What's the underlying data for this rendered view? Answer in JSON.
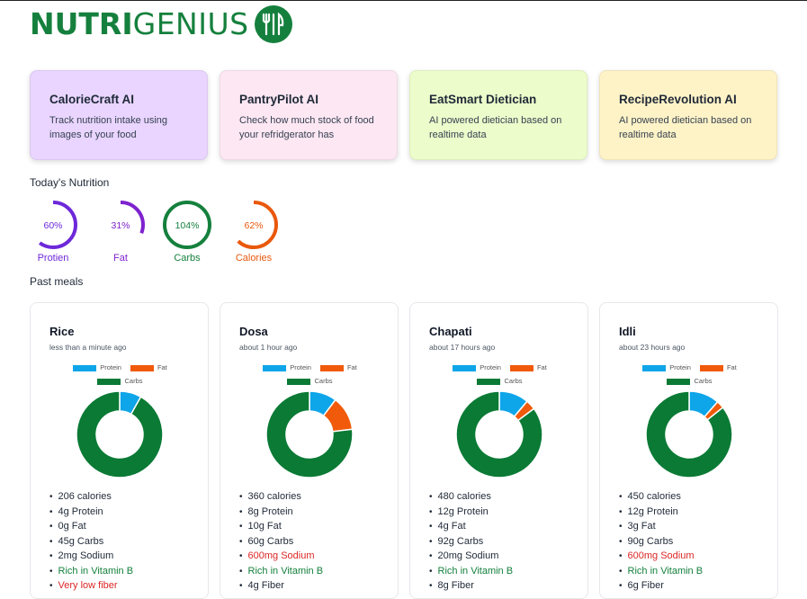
{
  "brand": {
    "name_bold": "NUTRI",
    "name_light": "GENIUS",
    "icon": "fork-knife-icon",
    "color": "#15803d"
  },
  "apps": [
    {
      "title": "CalorieCraft AI",
      "description": "Track nutrition intake using images of your food",
      "bg": "#e9d5ff"
    },
    {
      "title": "PantryPilot AI",
      "description": "Check how much stock of food your refridgerator has",
      "bg": "#fce7f3"
    },
    {
      "title": "EatSmart Dietician",
      "description": "AI powered dietician based on realtime data",
      "bg": "#ecfccb"
    },
    {
      "title": "RecipeRevolution AI",
      "description": "AI powered dietician based on realtime data",
      "bg": "#fef3c7"
    }
  ],
  "today": {
    "title": "Today's Nutrition",
    "rings": [
      {
        "label": "Protien",
        "value_text": "60%",
        "fraction": 0.6,
        "color": "#6d28d9"
      },
      {
        "label": "Fat",
        "value_text": "31%",
        "fraction": 0.31,
        "color": "#7e22ce"
      },
      {
        "label": "Carbs",
        "value_text": "104%",
        "fraction": 1.0,
        "color": "#15803d"
      },
      {
        "label": "Calories",
        "value_text": "62%",
        "fraction": 0.62,
        "color": "#ea580c"
      }
    ]
  },
  "meals_section": {
    "title": "Past meals"
  },
  "legend": [
    {
      "label": "Protein",
      "color": "#0ea5e9"
    },
    {
      "label": "Fat",
      "color": "#f05a0a"
    },
    {
      "label": "Carbs",
      "color": "#0a7a35"
    }
  ],
  "meals": [
    {
      "name": "Rice",
      "time": "less than a minute ago",
      "protein": 4,
      "fat": 0,
      "carbs": 45,
      "facts": [
        {
          "text": "206 calories",
          "tone": "normal"
        },
        {
          "text": "4g Protein",
          "tone": "normal"
        },
        {
          "text": "0g Fat",
          "tone": "normal"
        },
        {
          "text": "45g Carbs",
          "tone": "normal"
        },
        {
          "text": "2mg Sodium",
          "tone": "normal"
        },
        {
          "text": "Rich in Vitamin B",
          "tone": "good"
        },
        {
          "text": "Very low fiber",
          "tone": "warn"
        }
      ]
    },
    {
      "name": "Dosa",
      "time": "about 1 hour ago",
      "protein": 8,
      "fat": 10,
      "carbs": 60,
      "facts": [
        {
          "text": "360 calories",
          "tone": "normal"
        },
        {
          "text": "8g Protein",
          "tone": "normal"
        },
        {
          "text": "10g Fat",
          "tone": "normal"
        },
        {
          "text": "60g Carbs",
          "tone": "normal"
        },
        {
          "text": "600mg Sodium",
          "tone": "warn"
        },
        {
          "text": "Rich in Vitamin B",
          "tone": "good"
        },
        {
          "text": "4g Fiber",
          "tone": "normal"
        }
      ]
    },
    {
      "name": "Chapati",
      "time": "about 17 hours ago",
      "protein": 12,
      "fat": 4,
      "carbs": 92,
      "facts": [
        {
          "text": "480 calories",
          "tone": "normal"
        },
        {
          "text": "12g Protein",
          "tone": "normal"
        },
        {
          "text": "4g Fat",
          "tone": "normal"
        },
        {
          "text": "92g Carbs",
          "tone": "normal"
        },
        {
          "text": "20mg Sodium",
          "tone": "normal"
        },
        {
          "text": "Rich in Vitamin B",
          "tone": "good"
        },
        {
          "text": "8g Fiber",
          "tone": "normal"
        }
      ]
    },
    {
      "name": "Idli",
      "time": "about 23 hours ago",
      "protein": 12,
      "fat": 3,
      "carbs": 90,
      "facts": [
        {
          "text": "450 calories",
          "tone": "normal"
        },
        {
          "text": "12g Protein",
          "tone": "normal"
        },
        {
          "text": "3g Fat",
          "tone": "normal"
        },
        {
          "text": "90g Carbs",
          "tone": "normal"
        },
        {
          "text": "600mg Sodium",
          "tone": "warn"
        },
        {
          "text": "Rich in Vitamin B",
          "tone": "good"
        },
        {
          "text": "6g Fiber",
          "tone": "normal"
        }
      ]
    }
  ]
}
